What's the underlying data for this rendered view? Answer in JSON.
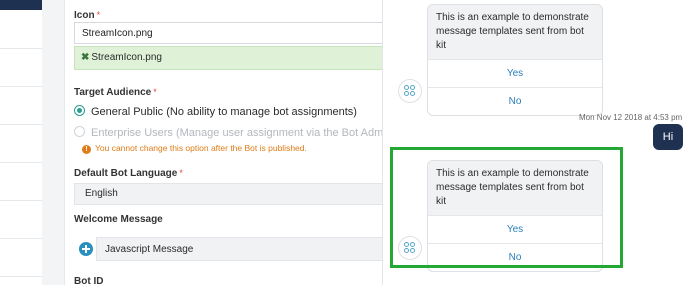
{
  "form": {
    "icon": {
      "label": "Icon",
      "required_mark": "*",
      "value": "StreamIcon.png",
      "uploaded_file": "StreamIcon.png",
      "remove_glyph": "✖"
    },
    "target_audience": {
      "label": "Target Audience",
      "required_mark": "*",
      "options": [
        {
          "label": "General Public (No ability to manage bot assignments)",
          "selected": true,
          "enabled": true
        },
        {
          "label": "Enterprise Users (Manage user assignment via the Bot Administr",
          "selected": false,
          "enabled": false
        }
      ],
      "warning": "You cannot change this option after the Bot is published.",
      "warning_icon": "!"
    },
    "default_language": {
      "label": "Default Bot Language",
      "required_mark": "*",
      "value": "English"
    },
    "welcome_message": {
      "label": "Welcome Message",
      "value": "Javascript Message",
      "icon": "plus-circle-icon"
    },
    "bot_id": {
      "label": "Bot ID"
    }
  },
  "chat": {
    "cards": [
      {
        "message": "This is an example to demonstrate message templates sent from bot kit",
        "options": [
          "Yes",
          "No"
        ]
      },
      {
        "message": "This is an example to demonstrate message templates sent from bot kit",
        "options": [
          "Yes",
          "No"
        ]
      }
    ],
    "timestamp": "Mon Nov 12 2018 at 4:53 pm",
    "user_message": "Hi"
  },
  "colors": {
    "accent": "#2a9d8f",
    "warning": "#e07b16",
    "highlight": "#22a833",
    "user_bubble": "#1f3150",
    "link": "#2a7eb8"
  }
}
